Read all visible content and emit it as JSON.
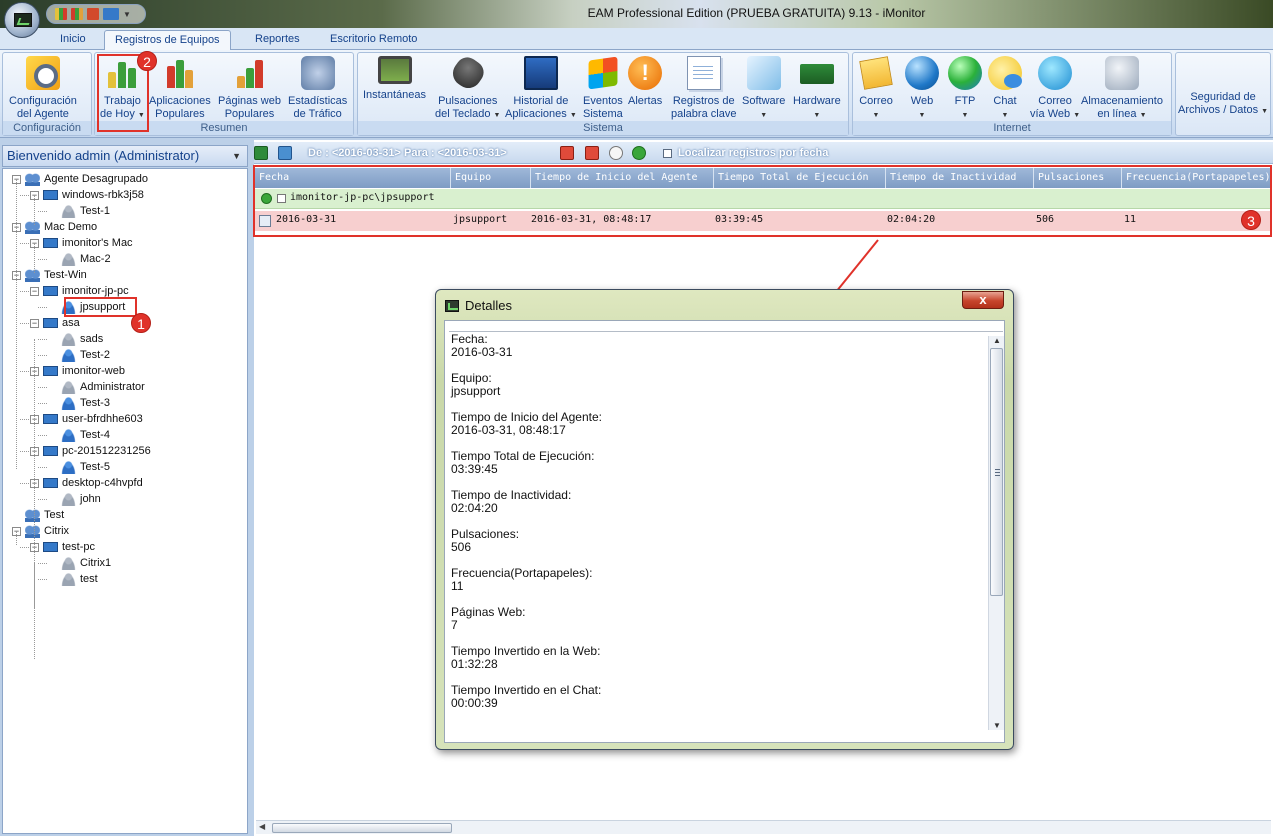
{
  "window": {
    "title": "EAM Professional Edition (PRUEBA GRATUITA) 9.13 - iMonitor"
  },
  "tabs": [
    {
      "label": "Inicio"
    },
    {
      "label": "Registros de Equipos"
    },
    {
      "label": "Reportes"
    },
    {
      "label": "Escritorio Remoto"
    }
  ],
  "ribbon": {
    "groups": {
      "configuracion": "Configuración",
      "resumen": "Resumen",
      "sistema": "Sistema",
      "internet": "Internet"
    },
    "buttons": {
      "config": [
        "Configuración",
        "del Agente"
      ],
      "trabajo": [
        "Trabajo",
        "de Hoy"
      ],
      "apps": [
        "Aplicaciones",
        "Populares"
      ],
      "paginas": [
        "Páginas web",
        "Populares"
      ],
      "estadisticas": [
        "Estadísticas",
        "de Tráfico"
      ],
      "instantaneas": [
        "Instantáneas",
        ""
      ],
      "pulsaciones": [
        "Pulsaciones",
        "del Teclado"
      ],
      "historial": [
        "Historial de",
        "Aplicaciones"
      ],
      "eventos": [
        "Eventos",
        "Sistema"
      ],
      "alertas": [
        "Alertas",
        ""
      ],
      "registros": [
        "Registros de",
        "palabra clave"
      ],
      "software": [
        "Software",
        ""
      ],
      "hardware": [
        "Hardware",
        ""
      ],
      "correo": [
        "Correo",
        ""
      ],
      "web": [
        "Web",
        ""
      ],
      "ftp": [
        "FTP",
        ""
      ],
      "chat": [
        "Chat",
        ""
      ],
      "correoweb": [
        "Correo",
        "vía Web"
      ],
      "almacenamiento": [
        "Almacenamiento",
        "en línea"
      ],
      "seguridad": [
        "Seguridad de",
        "Archivos / Datos"
      ]
    }
  },
  "left_panel": {
    "header": "Bienvenido admin (Administrator)",
    "tree": [
      "Agente Desagrupado",
      "windows-rbk3j58",
      "Test-1",
      "Mac Demo",
      "imonitor's Mac",
      "Mac-2",
      "Test-Win",
      "imonitor-jp-pc",
      "jpsupport",
      "asa",
      "sads",
      "Test-2",
      "imonitor-web",
      "Administrator",
      "Test-3",
      "user-bfrdhhe603",
      "Test-4",
      "pc-201512231256",
      "Test-5",
      "desktop-c4hvpfd",
      "john",
      "Test",
      "Citrix",
      "test-pc",
      "Citrix1",
      "test"
    ]
  },
  "toolbar": {
    "date_range": "De : <2016-03-31> Para : <2016-03-31>",
    "locate_label": "Localizar registros por fecha"
  },
  "grid": {
    "columns": [
      "Fecha",
      "Equipo",
      "Tiempo de Inicio del Agente",
      "Tiempo Total de Ejecución",
      "Tiempo de Inactividad",
      "Pulsaciones",
      "Frecuencia(Portapapeles)"
    ],
    "group_label": "imonitor-jp-pc\\jpsupport",
    "row": [
      "2016-03-31",
      "jpsupport",
      "2016-03-31, 08:48:17",
      "03:39:45",
      "02:04:20",
      "506",
      "11"
    ]
  },
  "callouts": [
    "1",
    "2",
    "3"
  ],
  "dialog": {
    "title": "Detalles",
    "close": "x",
    "fields": [
      {
        "label": "Fecha:",
        "value": "2016-03-31"
      },
      {
        "label": "Equipo:",
        "value": "jpsupport"
      },
      {
        "label": "Tiempo de Inicio del Agente:",
        "value": "2016-03-31, 08:48:17"
      },
      {
        "label": "Tiempo Total de Ejecución:",
        "value": "03:39:45"
      },
      {
        "label": "Tiempo de Inactividad:",
        "value": "02:04:20"
      },
      {
        "label": "Pulsaciones:",
        "value": "506"
      },
      {
        "label": "Frecuencia(Portapapeles):",
        "value": "11"
      },
      {
        "label": "Páginas Web:",
        "value": "7"
      },
      {
        "label": "Tiempo Invertido en la Web:",
        "value": "01:32:28"
      },
      {
        "label": "Tiempo Invertido en el Chat:",
        "value": "00:00:39"
      }
    ]
  },
  "colors": {
    "callout_red": "#e0322a",
    "selected_row": "#f7cfcf",
    "group_row": "#d9f0cf"
  }
}
